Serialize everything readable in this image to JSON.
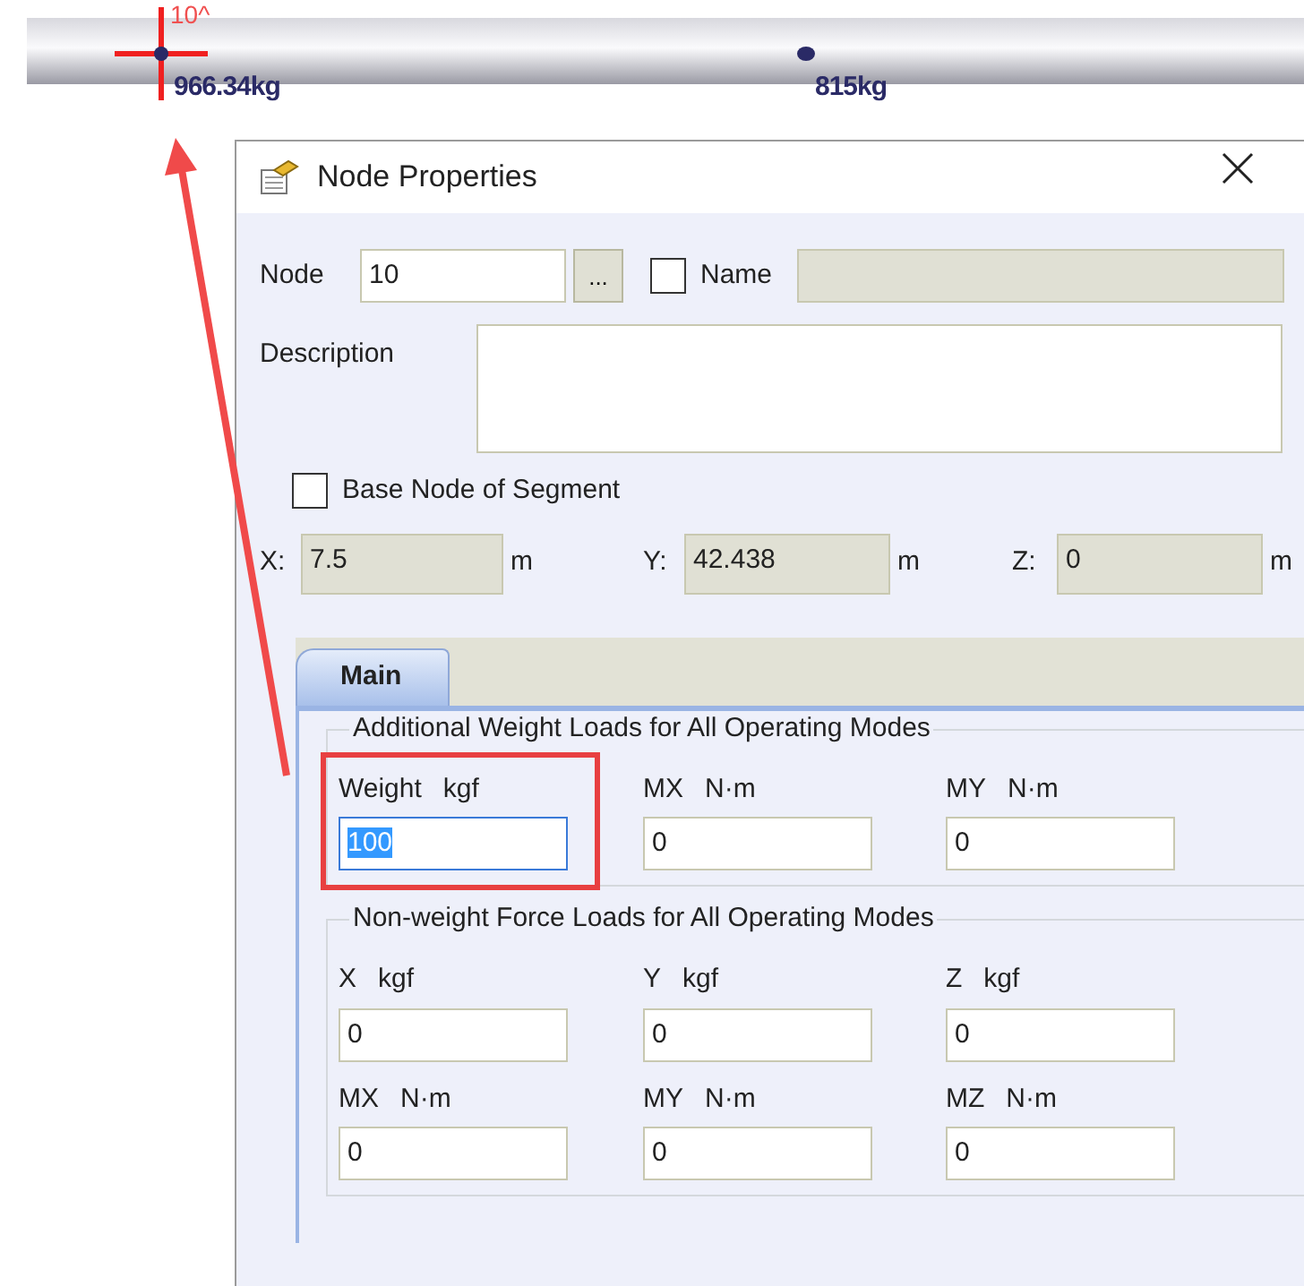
{
  "canvas": {
    "node_label": "10^",
    "nodes": [
      {
        "weight": "966.34kg",
        "selected": true
      },
      {
        "weight": "815kg",
        "selected": false
      }
    ]
  },
  "dialog": {
    "title": "Node Properties",
    "node": {
      "label": "Node",
      "value": "10",
      "browse": "..."
    },
    "name": {
      "label": "Name",
      "checked": false,
      "disabled": true
    },
    "description": {
      "label": "Description"
    },
    "base_node": {
      "label": "Base Node of Segment",
      "checked": false
    },
    "coordinates": [
      {
        "label": "X:",
        "value": "7.5",
        "unit": "m"
      },
      {
        "label": "Y:",
        "value": "42.438",
        "unit": "m"
      },
      {
        "label": "Z:",
        "value": "0",
        "unit": "m"
      }
    ],
    "tabs": [
      {
        "label": "Main",
        "selected": true
      }
    ],
    "groups": [
      {
        "title": "Additional Weight Loads for All Operating Modes",
        "fields": [
          {
            "label": "Weight",
            "unit": "kgf",
            "value": "100",
            "text_selected": true,
            "annotated": true
          },
          {
            "label": "MX",
            "unit": "N·m",
            "value": "0",
            "text_selected": false,
            "annotated": false
          },
          {
            "label": "MY",
            "unit": "N·m",
            "value": "0",
            "text_selected": false,
            "annotated": false
          }
        ]
      },
      {
        "title": "Non-weight Force Loads for All Operating Modes",
        "fields": [
          {
            "label": "X",
            "unit": "kgf",
            "value": "0",
            "text_selected": false,
            "annotated": false
          },
          {
            "label": "Y",
            "unit": "kgf",
            "value": "0",
            "text_selected": false,
            "annotated": false
          },
          {
            "label": "Z",
            "unit": "kgf",
            "value": "0",
            "text_selected": false,
            "annotated": false
          },
          {
            "label": "MX",
            "unit": "N·m",
            "value": "0",
            "text_selected": false,
            "annotated": false
          },
          {
            "label": "MY",
            "unit": "N·m",
            "value": "0",
            "text_selected": false,
            "annotated": false
          },
          {
            "label": "MZ",
            "unit": "N·m",
            "value": "0",
            "text_selected": false,
            "annotated": false
          }
        ]
      }
    ]
  }
}
